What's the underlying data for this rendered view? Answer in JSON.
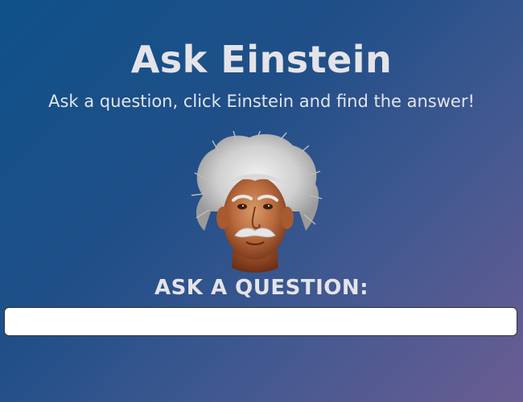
{
  "header": {
    "title": "Ask Einstein",
    "subtitle": "Ask a question, click Einstein and find the answer!"
  },
  "einstein": {
    "icon": "einstein-portrait-icon"
  },
  "question": {
    "label": "ASK A QUESTION:",
    "value": "",
    "placeholder": ""
  },
  "colors": {
    "gradient_start": "#0f5189",
    "gradient_end": "#6a5d93",
    "text": "#e4e4e8",
    "input_bg": "#ffffff"
  }
}
